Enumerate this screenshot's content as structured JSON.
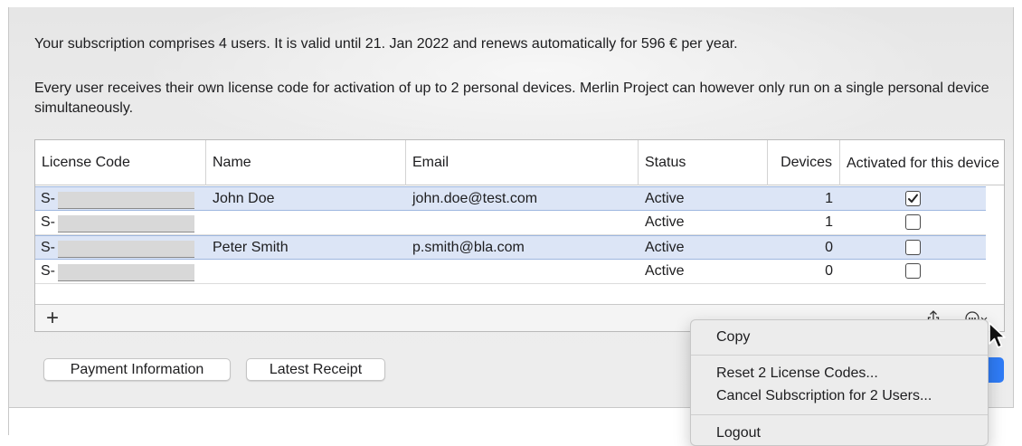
{
  "intro": {
    "subscription_text": "Your subscription comprises 4 users. It is valid until 21. Jan 2022 and renews automatically for 596 € per year.",
    "license_text": "Every user receives their own license code for activation of up to 2 personal devices. Merlin Project can however only run on a single personal device simultaneously."
  },
  "table": {
    "columns": {
      "license_code": "License Code",
      "name": "Name",
      "email": "Email",
      "status": "Status",
      "devices": "Devices",
      "activated": "Activated for this device"
    },
    "rows": [
      {
        "code_prefix": "S-",
        "name": "John Doe",
        "email": "john.doe@test.com",
        "status": "Active",
        "devices": "1",
        "activated": true,
        "selected": true
      },
      {
        "code_prefix": "S-",
        "name": "",
        "email": "",
        "status": "Active",
        "devices": "1",
        "activated": false,
        "selected": false
      },
      {
        "code_prefix": "S-",
        "name": "Peter Smith",
        "email": "p.smith@bla.com",
        "status": "Active",
        "devices": "0",
        "activated": false,
        "selected": true
      },
      {
        "code_prefix": "S-",
        "name": "",
        "email": "",
        "status": "Active",
        "devices": "0",
        "activated": false,
        "selected": false
      }
    ],
    "add_label": "+"
  },
  "buttons": {
    "payment_information": "Payment Information",
    "latest_receipt": "Latest Receipt"
  },
  "context_menu": {
    "copy": "Copy",
    "reset": "Reset 2 License Codes...",
    "cancel": "Cancel Subscription for 2 Users...",
    "logout": "Logout"
  },
  "icons": {
    "add": "plus-icon",
    "share": "share-icon",
    "more": "ellipsis-circle-chevron-icon",
    "checkbox": "checkmark-icon",
    "cursor": "mouse-pointer-icon"
  },
  "colors": {
    "selection": "#dce5f6",
    "accent": "#2f7cf6"
  }
}
